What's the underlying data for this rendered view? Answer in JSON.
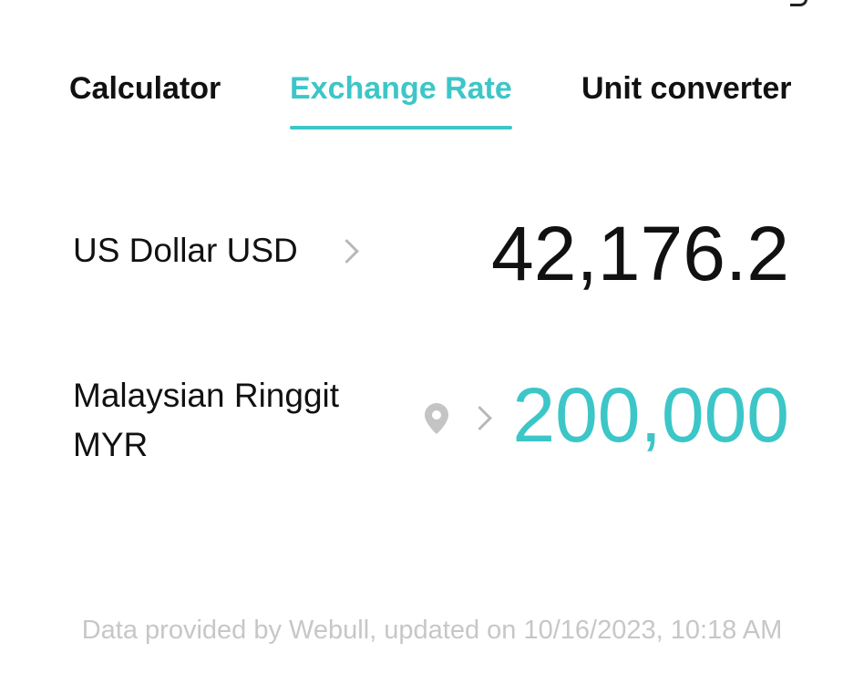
{
  "tabs": {
    "calculator": "Calculator",
    "exchange_rate": "Exchange Rate",
    "unit_converter": "Unit converter",
    "active": "Exchange Rate"
  },
  "rows": [
    {
      "currency": "US Dollar USD",
      "amount": "42,176.2"
    },
    {
      "currency": "Malaysian Ringgit MYR",
      "amount": "200,000"
    }
  ],
  "footer": {
    "note": "Data provided by Webull, updated on 10/16/2023, 10:18 AM"
  },
  "colors": {
    "accent": "#3cc6c8",
    "text": "#111111",
    "muted": "#c7c7c7"
  },
  "icons": {
    "chevron": "chevron-right-icon",
    "location": "location-pin-icon"
  }
}
